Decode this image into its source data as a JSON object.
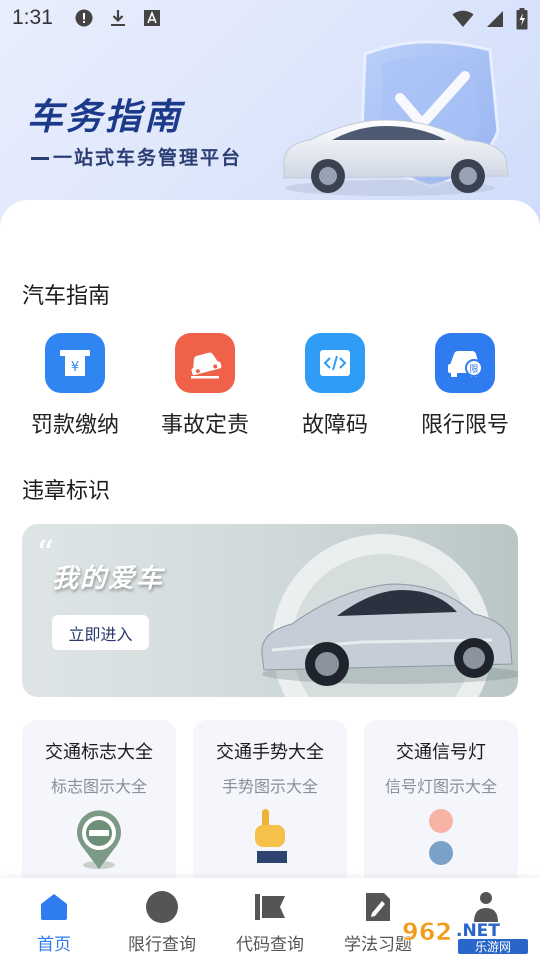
{
  "status_bar": {
    "time": "1:31",
    "icons": [
      "alert-icon",
      "download-icon",
      "font-icon",
      "wifi-icon",
      "signal-icon",
      "battery-icon"
    ]
  },
  "hero": {
    "title": "车务指南",
    "subtitle": "一站式车务管理平台"
  },
  "guide": {
    "title": "汽车指南",
    "items": [
      {
        "label": "罚款缴纳",
        "icon": "fine-payment-icon",
        "color": "#2f86f2"
      },
      {
        "label": "事故定责",
        "icon": "accident-icon",
        "color": "#f0614a"
      },
      {
        "label": "故障码",
        "icon": "fault-code-icon",
        "color": "#2f9cf5"
      },
      {
        "label": "限行限号",
        "icon": "restriction-icon",
        "color": "#2f7bf0"
      }
    ]
  },
  "violation": {
    "title": "违章标识"
  },
  "banner": {
    "title": "我的爱车",
    "button": "立即进入"
  },
  "cards": [
    {
      "title": "交通标志大全",
      "subtitle": "标志图示大全",
      "icon": "traffic-sign-icon"
    },
    {
      "title": "交通手势大全",
      "subtitle": "手势图示大全",
      "icon": "hand-gesture-icon"
    },
    {
      "title": "交通信号灯",
      "subtitle": "信号灯图示大全",
      "icon": "signal-light-icon"
    }
  ],
  "nav": {
    "items": [
      {
        "label": "首页",
        "icon": "home-icon",
        "active": true
      },
      {
        "label": "限行查询",
        "icon": "restriction-query-icon",
        "active": false
      },
      {
        "label": "代码查询",
        "icon": "code-query-icon",
        "active": false
      },
      {
        "label": "学法习题",
        "icon": "study-icon",
        "active": false
      },
      {
        "label": "",
        "icon": "profile-icon",
        "active": false
      }
    ]
  },
  "colors": {
    "accent": "#2f7bf0",
    "hero_title": "#1c3a8a",
    "card_bg": "#f4f6fb"
  },
  "watermark": {
    "text": "962.NET",
    "subtext": "乐游网"
  }
}
